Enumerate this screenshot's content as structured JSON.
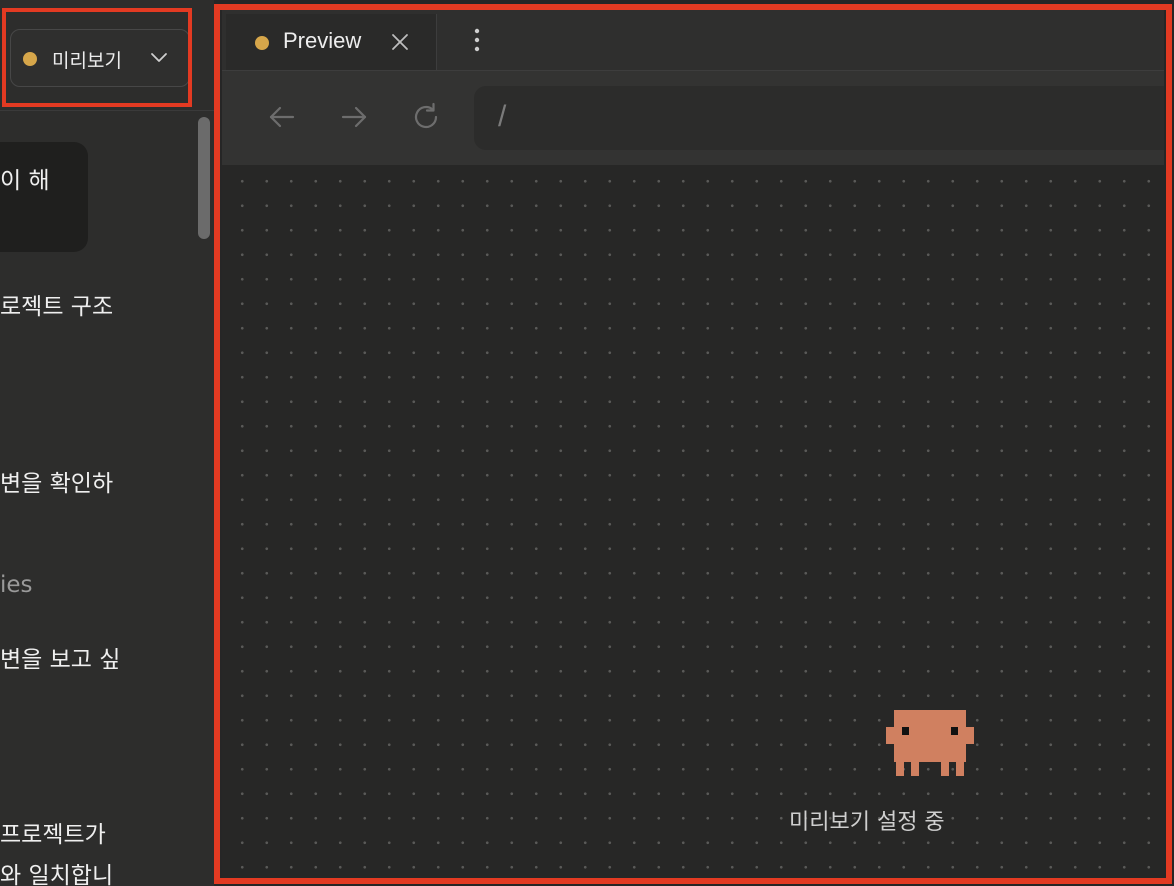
{
  "sidebar": {
    "preview_select": {
      "label": "미리보기",
      "status_color": "#d6a64a"
    },
    "chat_lines": [
      "이 해",
      "로젝트 구조",
      "변을 확인하",
      "ies",
      "변을 보고 싶",
      "프로젝트가",
      "와 일치합니"
    ]
  },
  "preview_pane": {
    "tab": {
      "label": "Preview",
      "status_color": "#d6a64a",
      "close_icon": "close-icon"
    },
    "more_icon": "vertical-ellipsis-icon",
    "toolbar": {
      "back_icon": "arrow-left-icon",
      "forward_icon": "arrow-right-icon",
      "reload_icon": "reload-icon",
      "url": "/"
    },
    "status_message": "미리보기 설정 중"
  },
  "colors": {
    "highlight": "#e33a22",
    "mascot": "#d08060",
    "background": "#262626"
  }
}
